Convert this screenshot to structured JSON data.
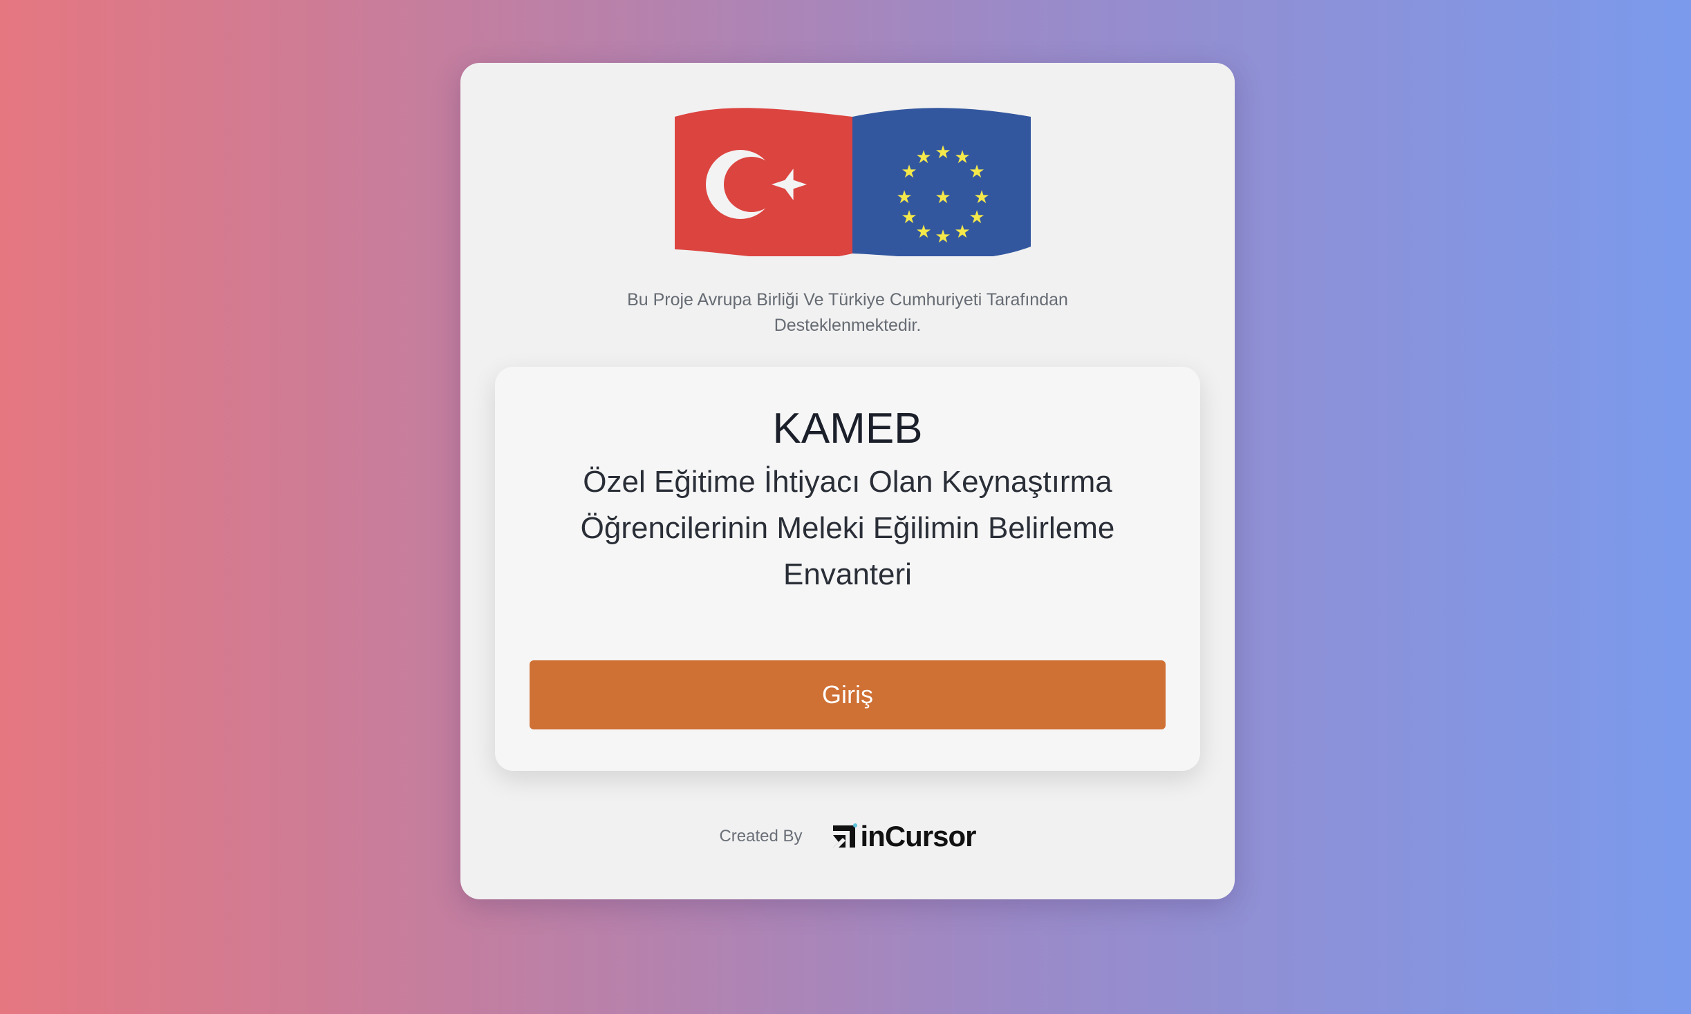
{
  "support_text": "Bu Proje Avrupa Birliği Ve Türkiye Cumhuriyeti Tarafından Desteklenmektedir.",
  "main": {
    "title": "KAMEB",
    "subtitle": "Özel Eğitime İhtiyacı Olan Keynaştırma Öğrencilerinin Meleki Eğilimin Belirleme Envanteri",
    "login_label": "Giriş"
  },
  "footer": {
    "created_by": "Created By",
    "brand_name": "inCursor"
  },
  "icons": {
    "flags": "turkey-eu-flags-logo",
    "brand": "incursor-logo"
  },
  "colors": {
    "button": "#cf7034",
    "turkey_red": "#dc4440",
    "eu_blue": "#33579f",
    "eu_star": "#f4e84a"
  }
}
